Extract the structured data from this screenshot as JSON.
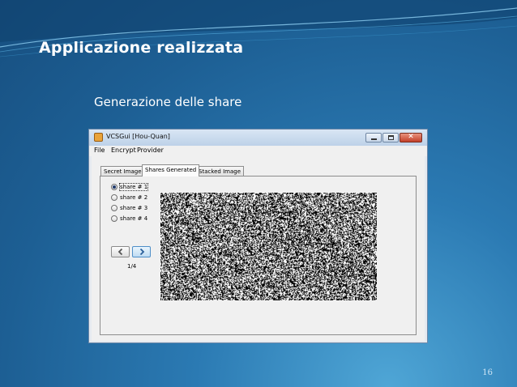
{
  "slide": {
    "title": "Applicazione realizzata",
    "subtitle": "Generazione delle share",
    "page_number": "16"
  },
  "window": {
    "title": "VCSGui  [Hou-Quan]",
    "controls": {
      "close": "✕"
    },
    "menu": [
      "File",
      "Encrypt",
      "Provider"
    ],
    "tabs": [
      "Secret Image",
      "Shares Generated",
      "Stacked Image"
    ],
    "active_tab": "Shares Generated",
    "shares": [
      "share # 1",
      "share # 2",
      "share # 3",
      "share # 4"
    ],
    "selected_share": "share # 1",
    "nav": {
      "prev_icon": "chevron-left-icon",
      "next_icon": "chevron-right-icon"
    },
    "counter": "1/4"
  },
  "colors": {
    "background": "#1d5f94",
    "window_border": "#6e89a9",
    "close_button": "#c2402a",
    "nav_chevron": "#2b5f99"
  }
}
